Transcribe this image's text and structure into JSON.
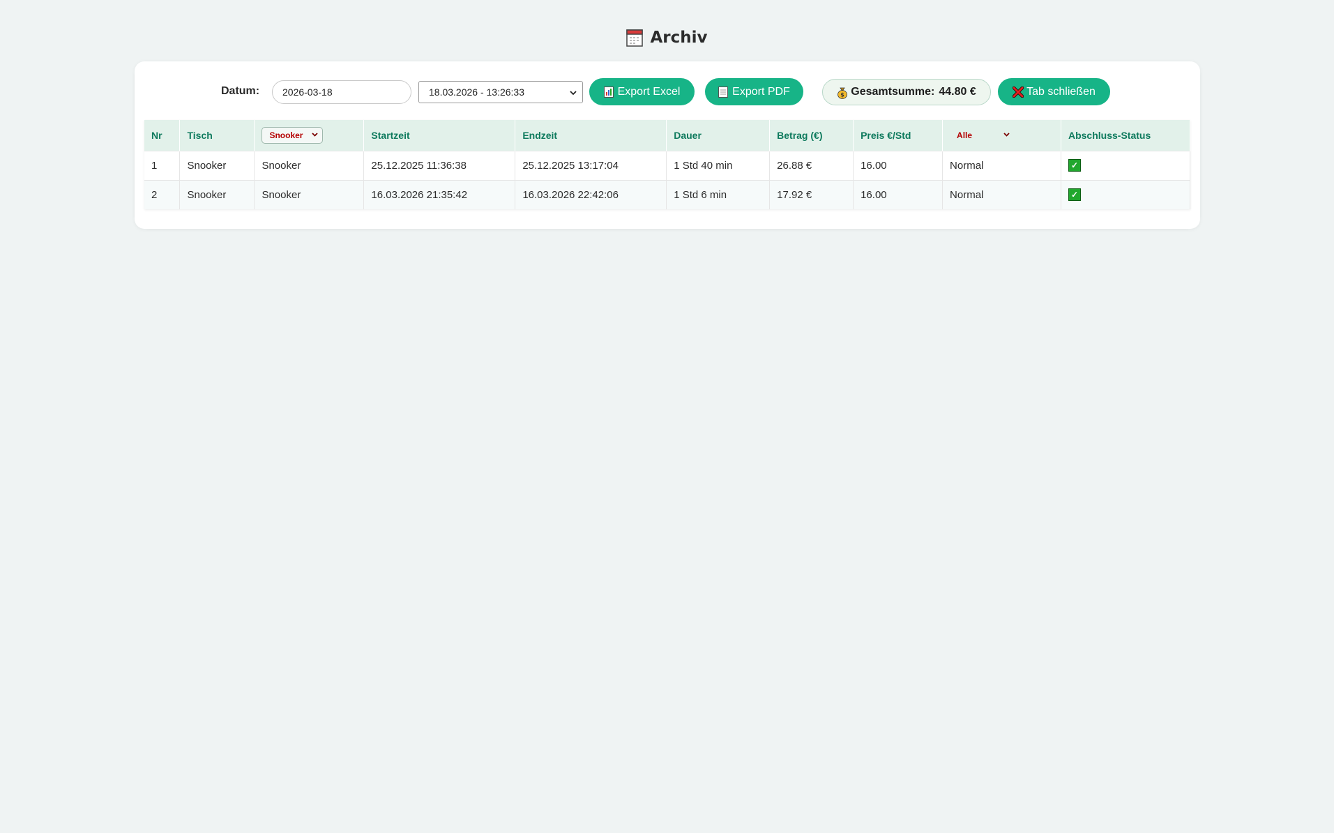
{
  "page": {
    "title": "Archiv",
    "title_icon": "calendar-icon"
  },
  "toolbar": {
    "date_label": "Datum:",
    "date_value": "2026-03-18",
    "session_selected": "18.03.2026 - 13:26:33",
    "export_excel_label": "Export Excel",
    "export_excel_icon": "bar-chart-icon",
    "export_pdf_label": "Export PDF",
    "export_pdf_icon": "document-icon",
    "total_label": "Gesamtsumme:",
    "total_value": "44.80 €",
    "total_icon": "money-bag-icon",
    "close_tab_label": "Tab schließen",
    "close_tab_icon": "cross-icon"
  },
  "colors": {
    "accent": "#17b487",
    "header_bg": "#e2f1ea",
    "header_text": "#0e7a5d",
    "filter_text": "#b40000",
    "check": "#20a72d"
  },
  "table": {
    "headers": {
      "nr": "Nr",
      "tisch": "Tisch",
      "type_filter": "Snooker",
      "startzeit": "Startzeit",
      "endzeit": "Endzeit",
      "dauer": "Dauer",
      "betrag": "Betrag (€)",
      "preis": "Preis €/Std",
      "mode_filter": "Alle",
      "status": "Abschluss-Status"
    },
    "rows": [
      {
        "nr": "1",
        "tisch": "Snooker",
        "typ": "Snooker",
        "startzeit": "25.12.2025 11:36:38",
        "endzeit": "25.12.2025 13:17:04",
        "dauer": "1 Std 40 min",
        "betrag": "26.88 €",
        "preis": "16.00",
        "modus": "Normal",
        "status_icon": "check-mark-icon"
      },
      {
        "nr": "2",
        "tisch": "Snooker",
        "typ": "Snooker",
        "startzeit": "16.03.2026 21:35:42",
        "endzeit": "16.03.2026 22:42:06",
        "dauer": "1 Std 6 min",
        "betrag": "17.92 €",
        "preis": "16.00",
        "modus": "Normal",
        "status_icon": "check-mark-icon"
      }
    ]
  }
}
